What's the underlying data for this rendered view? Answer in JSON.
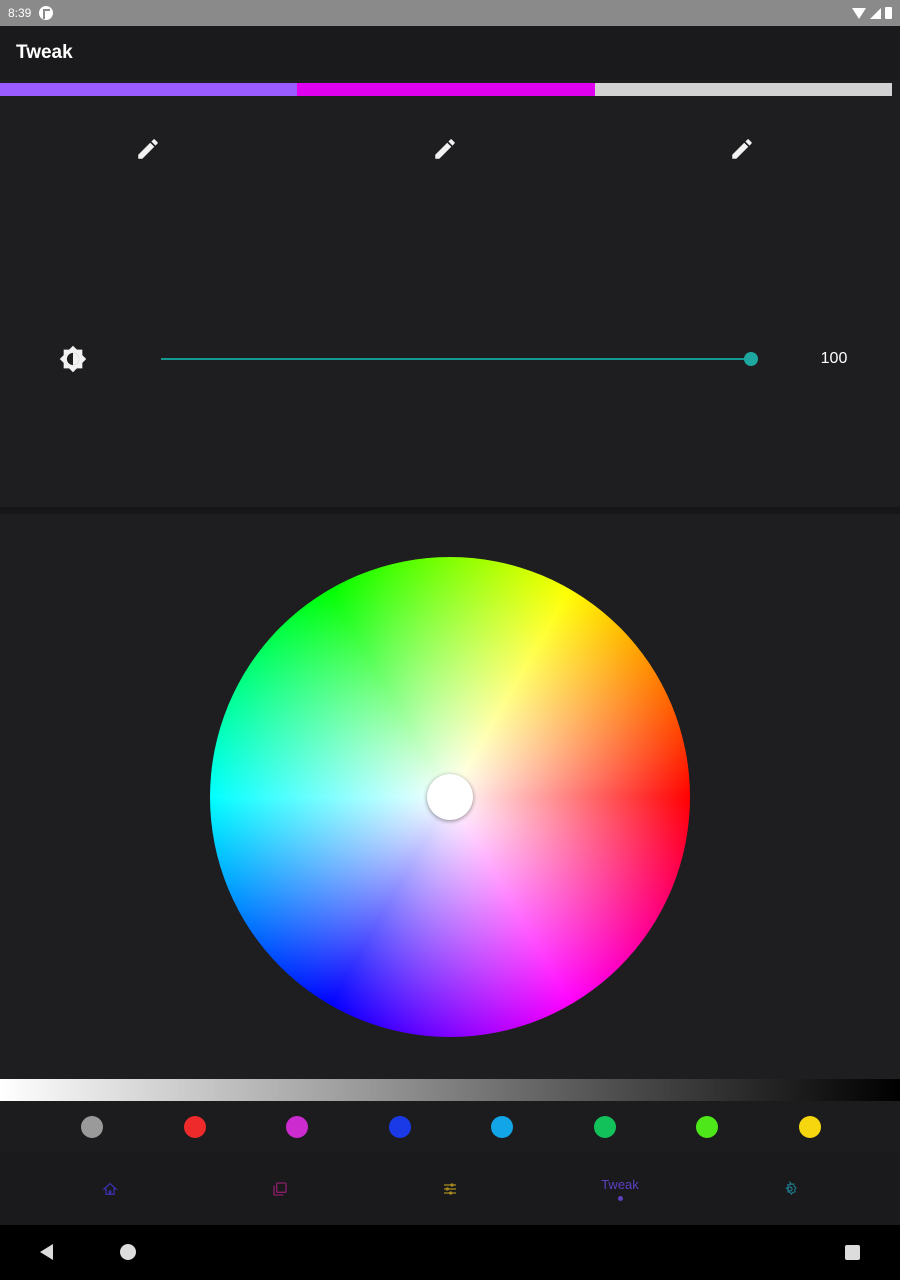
{
  "status_bar": {
    "time": "8:39"
  },
  "app_bar": {
    "title": "Tweak"
  },
  "color_strip": {
    "colors": [
      "#9a5cff",
      "#e000f0",
      "#d3d3d3"
    ]
  },
  "edit_buttons": {
    "icon": "edit-icon",
    "count": 3
  },
  "brightness": {
    "icon": "brightness-icon",
    "value": "100",
    "level": 1.0,
    "track_color": "#159a93"
  },
  "color_wheel": {
    "selected_color": "#ffffff",
    "handle_position": "center"
  },
  "gray_gradient": {
    "from": "#ffffff",
    "to": "#000000"
  },
  "swatches": [
    {
      "name": "gray",
      "color": "#9a9a9a"
    },
    {
      "name": "red",
      "color": "#ee2a2a"
    },
    {
      "name": "magenta",
      "color": "#cc2bd0"
    },
    {
      "name": "blue",
      "color": "#1a3ae8"
    },
    {
      "name": "sky-blue",
      "color": "#12a6e8"
    },
    {
      "name": "green",
      "color": "#12c15a"
    },
    {
      "name": "lime",
      "color": "#4ee81a"
    },
    {
      "name": "yellow",
      "color": "#f5d60f"
    }
  ],
  "bottom_nav": {
    "items": [
      {
        "id": "home",
        "icon": "home-icon",
        "color": "#3a2fa8"
      },
      {
        "id": "scenes",
        "icon": "layers-icon",
        "color": "#8c1e6a"
      },
      {
        "id": "adjust",
        "icon": "sliders-icon",
        "color": "#a88a1e"
      },
      {
        "id": "tweak",
        "label": "Tweak",
        "color": "#5d40c2",
        "selected": true
      },
      {
        "id": "settings",
        "icon": "gear-icon",
        "color": "#1e7a8a"
      }
    ]
  }
}
